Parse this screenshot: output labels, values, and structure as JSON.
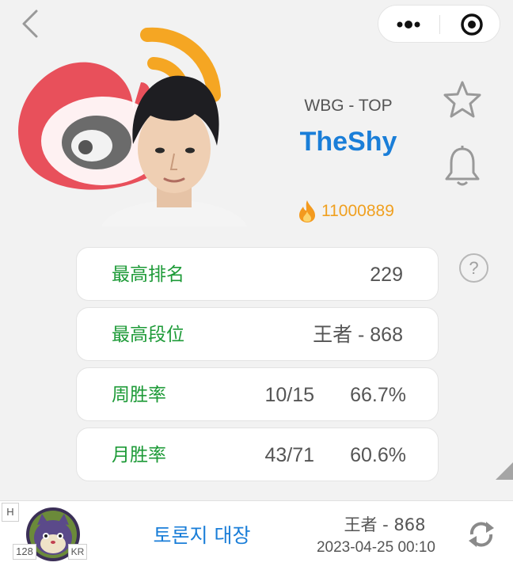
{
  "nav": {
    "back_icon": "chevron-left-icon",
    "more_icon": "more-dots-icon",
    "close_icon": "target-close-icon"
  },
  "player": {
    "team_position": "WBG - TOP",
    "name": "TheShy",
    "heat_icon": "fire-icon",
    "heat": "11000889"
  },
  "actions": {
    "favorite_icon": "star-icon",
    "notify_icon": "bell-icon",
    "help_label": "?"
  },
  "stats": [
    {
      "label": "最高排名",
      "value": "229"
    },
    {
      "label": "最高段位",
      "value": "王者 - 868"
    },
    {
      "label": "周胜率",
      "record": "10/15",
      "rate": "66.7%"
    },
    {
      "label": "月胜率",
      "record": "43/71",
      "rate": "60.6%"
    }
  ],
  "account": {
    "server_badge": "H",
    "level": "128",
    "region": "KR",
    "summoner": "토론지 대장",
    "rank": "王者 - 868",
    "updated": "2023-04-25 00:10",
    "refresh_icon": "refresh-icon"
  },
  "colors": {
    "accent_blue": "#1a7ed8",
    "label_green": "#1d9a37",
    "heat_orange": "#f0a020",
    "weibo_red": "#e8505b",
    "weibo_yellow": "#f5a623"
  }
}
